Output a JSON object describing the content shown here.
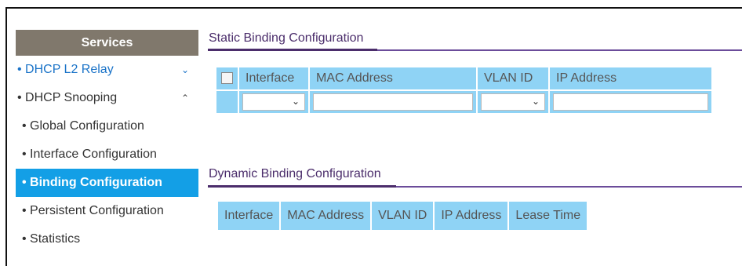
{
  "sidebar": {
    "header": "Services",
    "items": [
      {
        "label": "• DHCP L2 Relay",
        "chev": "⌄"
      },
      {
        "label": "• DHCP Snooping",
        "chev": "⌃"
      },
      {
        "label": "• Global Configuration"
      },
      {
        "label": "• Interface Configuration"
      },
      {
        "label": "• Binding Configuration"
      },
      {
        "label": "• Persistent Configuration"
      },
      {
        "label": "• Statistics"
      }
    ]
  },
  "static": {
    "title": "Static Binding Configuration",
    "headers": [
      "Interface",
      "MAC Address",
      "VLAN ID",
      "IP Address"
    ],
    "interface_value": "",
    "mac_value": "",
    "vlan_value": "",
    "ip_value": ""
  },
  "dynamic": {
    "title": "Dynamic Binding Configuration",
    "headers": [
      "Interface",
      "MAC Address",
      "VLAN ID",
      "IP Address",
      "Lease Time"
    ]
  },
  "colors": {
    "accent": "#139fe6",
    "table": "#8fd3f5",
    "title": "#4b2d6b",
    "sidebar_header": "#80786c"
  }
}
